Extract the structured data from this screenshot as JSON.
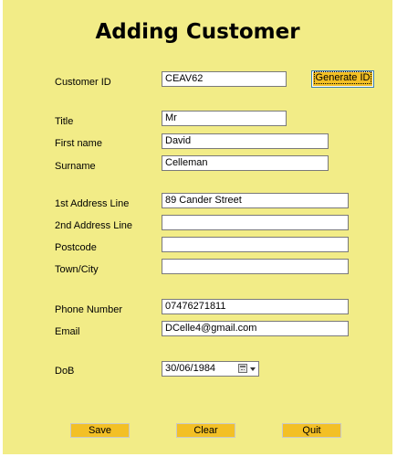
{
  "form": {
    "title": "Adding Customer",
    "generate_label": "Generate ID",
    "labels": {
      "customer_id": "Customer ID",
      "title": "Title",
      "first_name": "First name",
      "surname": "Surname",
      "address1": "1st Address Line",
      "address2": "2nd Address Line",
      "postcode": "Postcode",
      "town": "Town/City",
      "phone": "Phone Number",
      "email": "Email",
      "dob": "DoB"
    },
    "values": {
      "customer_id": "CEAV62",
      "title": "Mr",
      "first_name": "David",
      "surname": "Celleman",
      "address1": "89 Cander Street",
      "address2": "",
      "postcode": "",
      "town": "",
      "phone": "07476271811",
      "email": "DCelle4@gmail.com",
      "dob": "30/06/1984"
    },
    "buttons": {
      "save": "Save",
      "clear": "Clear",
      "quit": "Quit"
    }
  }
}
